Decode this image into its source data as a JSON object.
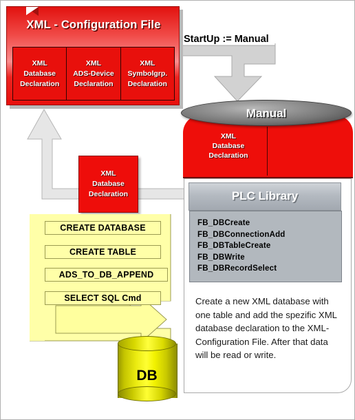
{
  "xml_config": {
    "title": "XML - Configuration File",
    "cells": [
      {
        "line1": "XML",
        "line2": "Database",
        "line3": "Declaration"
      },
      {
        "line1": "XML",
        "line2": "ADS-Device",
        "line3": "Declaration"
      },
      {
        "line1": "XML",
        "line2": "Symbolgrp.",
        "line3": "Declaration"
      }
    ]
  },
  "startup": {
    "label": "StartUp := Manual"
  },
  "manual": {
    "ellipse_label": "Manual",
    "box_line1": "XML",
    "box_line2": "Database",
    "box_line3": "Declaration"
  },
  "mid_declaration": {
    "line1": "XML",
    "line2": "Database",
    "line3": "Declaration"
  },
  "plc_library": {
    "title": "PLC Library",
    "function_blocks": [
      "FB_DBCreate",
      "FB_DBConnectionAdd",
      "FB_DBTableCreate",
      "FB_DBWrite",
      "FB_DBRecordSelect"
    ],
    "description": "Create a new XML database with one table and add the spezific XML database declaration to the XML-Configuration File. After that data will be read or write."
  },
  "commands": [
    "CREATE DATABASE",
    "CREATE TABLE",
    "ADS_TO_DB_APPEND",
    "SELECT SQL Cmd"
  ],
  "database": {
    "label": "DB"
  },
  "colors": {
    "red": "#ee0e0a",
    "yellow": "#ffff33",
    "command_yellow": "#ffffa8",
    "gray_arrow": "#e3e3e3",
    "panel_gray": "#b2b8be"
  }
}
